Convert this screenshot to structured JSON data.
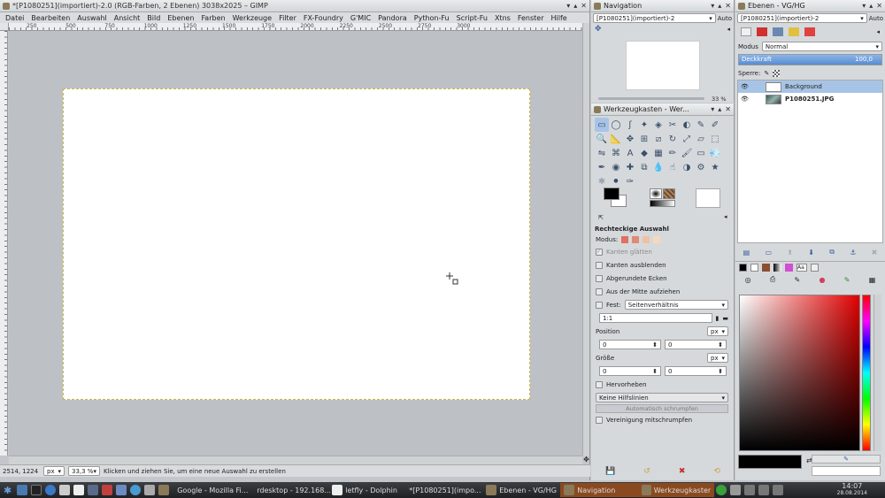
{
  "main_window": {
    "title": "*[P1080251](importiert)-2.0 (RGB-Farben, 2 Ebenen) 3038x2025 – GIMP",
    "menu": [
      "Datei",
      "Bearbeiten",
      "Auswahl",
      "Ansicht",
      "Bild",
      "Ebenen",
      "Farben",
      "Werkzeuge",
      "Filter",
      "FX-Foundry",
      "G'MIC",
      "Pandora",
      "Python-Fu",
      "Script-Fu",
      "Xtns",
      "Fenster",
      "Hilfe"
    ],
    "ruler_labels": [
      "250",
      "500",
      "750",
      "1000",
      "1250",
      "1500",
      "1750",
      "2000",
      "2250",
      "2500",
      "2750",
      "3000"
    ],
    "status": {
      "coords": "2514, 1224",
      "unit": "px",
      "zoom": "33,3 %",
      "message": "Klicken und ziehen Sie, um eine neue Auswahl zu erstellen"
    }
  },
  "navigation": {
    "title": "Navigation",
    "image_combo": "[P1080251](importiert)-2",
    "auto_label": "Auto",
    "zoom": "33 %"
  },
  "toolbox": {
    "title": "Werkzeugkasten - Wer...",
    "tool_options_title": "Rechteckige Auswahl",
    "mode_label": "Modus:",
    "options": {
      "antialias": "Kanten glätten",
      "feather": "Kanten ausblenden",
      "rounded": "Abgerundete Ecken",
      "from_center": "Aus der Mitte aufziehen",
      "fixed": "Fest:",
      "fixed_type": "Seitenverhältnis",
      "ratio": "1:1",
      "position_label": "Position",
      "position_unit": "px",
      "pos_x": "0",
      "pos_y": "0",
      "size_label": "Größe",
      "size_unit": "px",
      "size_w": "0",
      "size_h": "0",
      "highlight": "Hervorheben",
      "guides": "Keine Hilfslinien",
      "auto_shrink": "Automatisch schrumpfen",
      "shrink_merged": "Vereinigung mitschrumpfen"
    }
  },
  "layers": {
    "title": "Ebenen - VG/HG",
    "image_combo": "[P1080251](importiert)-2",
    "auto_label": "Auto",
    "mode_label": "Modus",
    "mode_value": "Normal",
    "opacity_label": "Deckkraft",
    "opacity_value": "100,0",
    "opacity_fraction": 1.0,
    "lock_label": "Sperre:",
    "items": [
      {
        "name": "Background",
        "selected": true
      },
      {
        "name": "P1080251.JPG",
        "selected": false
      }
    ]
  },
  "taskbar": {
    "items": [
      "Google - Mozilla Fi...",
      "rdesktop - 192.168...",
      "letfly - Dolphin",
      "*[P1080251](impo...",
      "Ebenen - VG/HG",
      "Navigation",
      "Werkzeugkasten..."
    ],
    "clock_time": "14:07",
    "clock_date": "28.08.2014"
  },
  "colors": {
    "accent": "#79a7dc",
    "selection": "#a7c4e6",
    "taskbar_orange": "#8a4a20"
  }
}
